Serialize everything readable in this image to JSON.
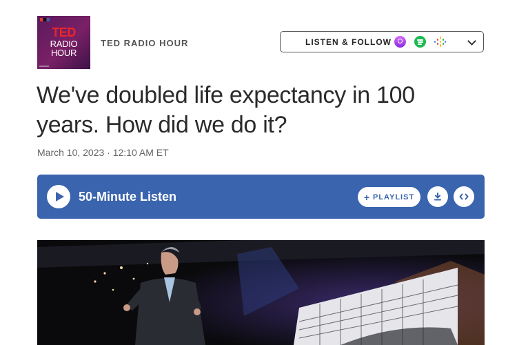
{
  "header": {
    "show_name": "TED RADIO HOUR",
    "logo": {
      "npr": "n p r",
      "ted": "TED",
      "radio": "RADIO",
      "hour": "HOUR"
    },
    "listen_follow": {
      "label": "LISTEN & FOLLOW",
      "icons": [
        "apple-podcasts-icon",
        "spotify-icon",
        "google-podcasts-icon",
        "chevron-down-icon"
      ]
    }
  },
  "article": {
    "title": "We've doubled life expectancy in 100 years. How did we do it?",
    "dateline": "March 10, 2023 · 12:10 AM ET"
  },
  "player": {
    "listen_label": "50-Minute Listen",
    "playlist_label": "PLAYLIST",
    "download_icon": "download-icon",
    "embed_icon": "embed-icon",
    "accent": "#3a64ad"
  },
  "colors": {
    "brand_red": "#e8262b",
    "logo_purple": "#6b1d63",
    "player_blue": "#3a64ad"
  }
}
